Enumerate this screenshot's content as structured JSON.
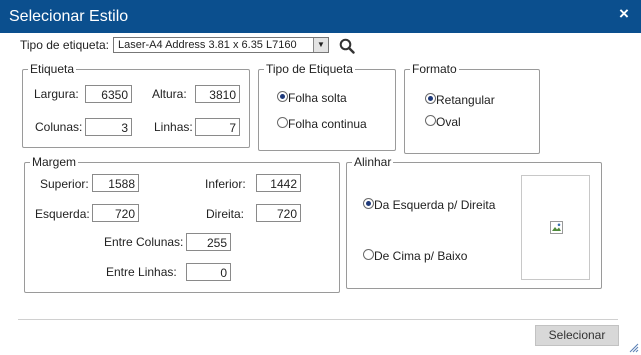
{
  "window": {
    "title": "Selecionar Estilo",
    "close_glyph": "×"
  },
  "tipo": {
    "label": "Tipo de etiqueta:",
    "selected": "Laser-A4 Address 3.81 x 6.35 L7160",
    "search_icon": "magnifier-icon"
  },
  "etiqueta": {
    "legend": "Etiqueta",
    "largura_label": "Largura:",
    "largura": "6350",
    "altura_label": "Altura:",
    "altura": "3810",
    "colunas_label": "Colunas:",
    "colunas": "3",
    "linhas_label": "Linhas:",
    "linhas": "7"
  },
  "tipo_etiqueta": {
    "legend": "Tipo de Etiqueta",
    "options": [
      {
        "label": "Folha solta",
        "selected": true
      },
      {
        "label": "Folha continua",
        "selected": false
      }
    ]
  },
  "formato": {
    "legend": "Formato",
    "options": [
      {
        "label": "Retangular",
        "selected": true
      },
      {
        "label": "Oval",
        "selected": false
      }
    ]
  },
  "margem": {
    "legend": "Margem",
    "superior_label": "Superior:",
    "superior": "1588",
    "inferior_label": "Inferior:",
    "inferior": "1442",
    "esquerda_label": "Esquerda:",
    "esquerda": "720",
    "direita_label": "Direita:",
    "direita": "720",
    "entre_colunas_label": "Entre Colunas:",
    "entre_colunas": "255",
    "entre_linhas_label": "Entre Linhas:",
    "entre_linhas": "0"
  },
  "alinhar": {
    "legend": "Alinhar",
    "options": [
      {
        "label": "Da Esquerda p/ Direita",
        "selected": true
      },
      {
        "label": "De Cima p/ Baixo",
        "selected": false
      }
    ]
  },
  "footer": {
    "button": "Selecionar"
  },
  "colors": {
    "titlebar": "#0b4f8e",
    "button_bg": "#d8d8d8"
  }
}
